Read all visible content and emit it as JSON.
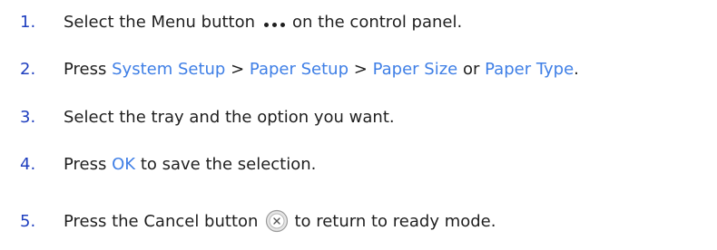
{
  "steps": [
    {
      "number": "1.",
      "before": "Select the Menu button",
      "icon": "menu-dots-icon",
      "after": "on the control panel."
    },
    {
      "number": "2.",
      "press": "Press",
      "link1": "System Setup",
      "sep1": ">",
      "link2": "Paper Setup",
      "sep2": ">",
      "link3": "Paper Size",
      "or": "or",
      "link4": "Paper Type",
      "end": "."
    },
    {
      "number": "3.",
      "text": "Select the tray and the option you want."
    },
    {
      "number": "4.",
      "press": "Press",
      "link": "OK",
      "after": "to save the selection."
    },
    {
      "number": "5.",
      "before": "Press the Cancel button",
      "icon": "cancel-x-icon",
      "after": "to return to ready mode."
    }
  ],
  "colors": {
    "number": "#1f3fbf",
    "link": "#3f7fe6",
    "text": "#1f1f1f"
  }
}
